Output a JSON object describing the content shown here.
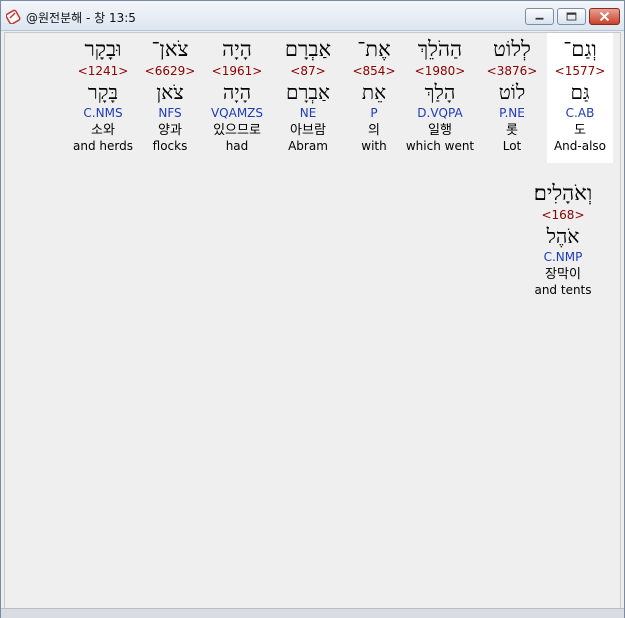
{
  "window": {
    "title": "@원전분해 - 창 13:5",
    "icon": "bible-app-icon"
  },
  "words": [
    {
      "hebrew": "וְגַם־",
      "strong": "<1577>",
      "lemma": "גַּם",
      "morph": "C.AB",
      "korean": "도",
      "english": "And-also",
      "selected": true
    },
    {
      "hebrew": "לְלוֹט",
      "strong": "<3876>",
      "lemma": "לוֹט",
      "morph": "P.NE",
      "korean": "롯",
      "english": "Lot",
      "selected": false
    },
    {
      "hebrew": "הַהֹלֵךְ",
      "strong": "<1980>",
      "lemma": "הָלַךְ",
      "morph": "D.VQPA",
      "korean": "일행",
      "english": "which went",
      "selected": false
    },
    {
      "hebrew": "אֶת־",
      "strong": "<854>",
      "lemma": "אֵת",
      "morph": "P",
      "korean": "의",
      "english": "with",
      "selected": false
    },
    {
      "hebrew": "אַבְרָם",
      "strong": "<87>",
      "lemma": "אַבְרָם",
      "morph": "NE",
      "korean": "아브람",
      "english": "Abram",
      "selected": false
    },
    {
      "hebrew": "הָיָה",
      "strong": "<1961>",
      "lemma": "הָיָה",
      "morph": "VQAMZS",
      "korean": "있으므로",
      "english": "had",
      "selected": false
    },
    {
      "hebrew": "צֹאן־",
      "strong": "<6629>",
      "lemma": "צֹאן",
      "morph": "NFS",
      "korean": "양과",
      "english": "flocks",
      "selected": false
    },
    {
      "hebrew": "וּבָקָר",
      "strong": "<1241>",
      "lemma": "בָּקָר",
      "morph": "C.NMS",
      "korean": "소와",
      "english": "and herds",
      "selected": false
    },
    {
      "hebrew": "וְאֹהָלִים׃",
      "strong": "<168>",
      "lemma": "אֹהֶל",
      "morph": "C.NMP",
      "korean": "장막이",
      "english": "and tents",
      "selected": false
    }
  ]
}
